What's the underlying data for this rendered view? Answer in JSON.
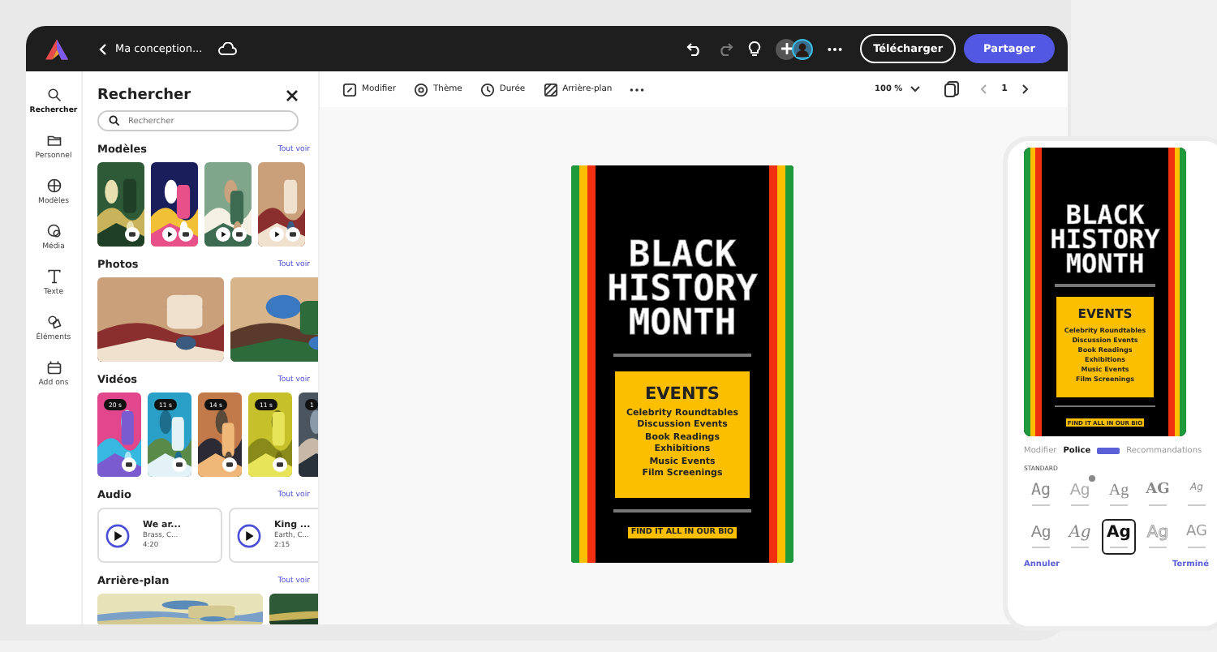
{
  "topbar": {
    "title": "Ma conception...",
    "download": "Télécharger",
    "share": "Partager"
  },
  "rail": [
    {
      "label": "Rechercher",
      "selected": true
    },
    {
      "label": "Personnel",
      "selected": false
    },
    {
      "label": "Modèles",
      "selected": false
    },
    {
      "label": "Média",
      "selected": false
    },
    {
      "label": "Texte",
      "selected": false
    },
    {
      "label": "Éléments",
      "selected": false
    },
    {
      "label": "Add ons",
      "selected": false
    }
  ],
  "panel": {
    "title": "Rechercher",
    "search": {
      "placeholder": "Rechercher"
    },
    "sections": [
      {
        "title": "Modèles",
        "link": "Tout voir",
        "kind": "templates",
        "items": [
          {
            "kind": "picture",
            "video": false
          },
          {
            "kind": "picture",
            "video": true
          },
          {
            "kind": "picture",
            "video": true
          },
          {
            "kind": "picture",
            "video": true
          }
        ]
      },
      {
        "title": "Photos",
        "link": "Tout voir",
        "kind": "photos",
        "items": [
          {
            "kind": "picture"
          },
          {
            "kind": "picture"
          }
        ]
      },
      {
        "title": "Vidéos",
        "link": "Tout voir",
        "kind": "videos",
        "items": [
          {
            "kind": "picture",
            "duration": "20 s"
          },
          {
            "kind": "picture",
            "duration": "11 s"
          },
          {
            "kind": "picture",
            "duration": "14 s"
          },
          {
            "kind": "picture",
            "duration": "11 s"
          },
          {
            "kind": "picture",
            "duration": "1"
          }
        ]
      },
      {
        "title": "Audio",
        "link": "Tout voir",
        "kind": "audio",
        "items": [
          {
            "title": "We ar...",
            "artist": "Brass, C...",
            "time": "4:20"
          },
          {
            "title": "King ...",
            "artist": "Earth, C...",
            "time": "2:15"
          }
        ]
      },
      {
        "title": "Arrière-plan",
        "link": "Tout voir",
        "kind": "backgrounds",
        "items": [
          {
            "kind": "picture"
          },
          {
            "kind": "picture"
          }
        ]
      }
    ]
  },
  "toolbar": {
    "items": [
      {
        "label": "Modifier"
      },
      {
        "label": "Thème"
      },
      {
        "label": "Durée"
      },
      {
        "label": "Arrière-plan"
      }
    ],
    "zoom": "100 %",
    "page": "1"
  },
  "canvas": {
    "poster": {
      "title": [
        "BLACK",
        "HISTORY",
        "MONTH"
      ],
      "heading": "EVENTS",
      "events": [
        "Celebrity Roundtables",
        "Discussion Events",
        "Book Readings",
        "Exhibitions",
        "Music Events",
        "Film Screenings"
      ],
      "footer": "FIND IT ALL IN OUR BIO"
    }
  },
  "phone": {
    "poster": {
      "title": [
        "BLACK",
        "HISTORY",
        "MONTH"
      ],
      "heading": "EVENTS",
      "events": [
        "Celebrity Roundtables",
        "Discussion Events",
        "Book Readings",
        "Exhibitions",
        "Music Events",
        "Film Screenings"
      ],
      "footer": "FIND IT ALL IN OUR BIO"
    },
    "tabs": [
      {
        "label": "Modifier",
        "selected": false
      },
      {
        "label": "Police",
        "selected": true
      },
      {
        "label": "Recommandations",
        "selected": false
      }
    ],
    "group": "STANDARD",
    "fonts": [
      {
        "sample": "Ag",
        "kind": "mono",
        "selected": false
      },
      {
        "sample": "Ag",
        "kind": "light",
        "selected": false,
        "premium": true
      },
      {
        "sample": "Ag",
        "kind": "serif",
        "selected": false
      },
      {
        "sample": "AG",
        "kind": "stencil",
        "selected": false
      },
      {
        "sample": "Ag",
        "kind": "tiny",
        "selected": false
      },
      {
        "sample": "Ag",
        "kind": "sans",
        "selected": false
      },
      {
        "sample": "Ag",
        "kind": "script",
        "selected": false
      },
      {
        "sample": "Ag",
        "kind": "bold",
        "selected": true
      },
      {
        "sample": "Ag",
        "kind": "outline",
        "selected": false
      },
      {
        "sample": "AG",
        "kind": "caps",
        "selected": false
      }
    ],
    "cancel": "Annuler",
    "done": "Terminé"
  }
}
